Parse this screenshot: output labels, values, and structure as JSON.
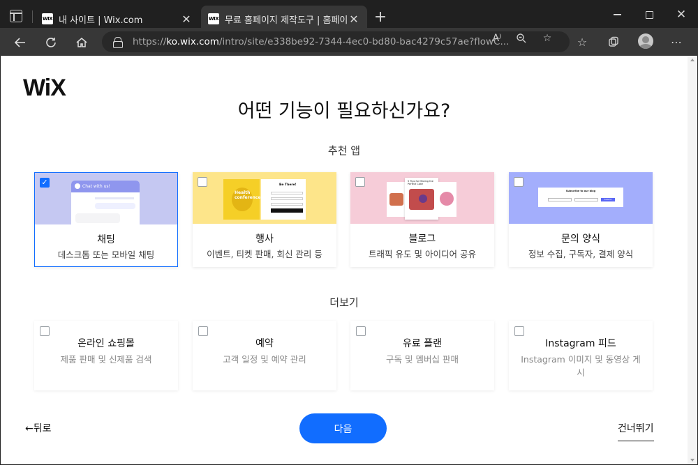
{
  "browser": {
    "tabs": [
      {
        "favicon": "WIX",
        "title": "내 사이트 | Wix.com",
        "active": false
      },
      {
        "favicon": "WIX",
        "title": "무료 홈페이지 제작도구 | 홈페이지",
        "active": true
      }
    ],
    "url": {
      "protocol": "https://",
      "host": "ko.wix.com",
      "path": "/intro/site/e338be92-7344-4ec0-bd80-bac4279c57ae?flowC..."
    }
  },
  "page": {
    "logo": "WiX",
    "heading": "어떤 기능이 필요하신가요?",
    "recommended_label": "추천 앱",
    "more_label": "더보기",
    "recommended": [
      {
        "title": "채팅",
        "subtitle": "데스크톱 또는 모바일 채팅",
        "checked": true,
        "image_bg": "#c5c8f2"
      },
      {
        "title": "행사",
        "subtitle": "이벤트, 티켓 판매, 회신 관리 등",
        "checked": false,
        "image_bg": "#fde58a"
      },
      {
        "title": "블로그",
        "subtitle": "트래픽 유도 및 아이디어 공유",
        "checked": false,
        "image_bg": "#f6ccd8"
      },
      {
        "title": "문의 양식",
        "subtitle": "정보 수집, 구독자, 결제 양식",
        "checked": false,
        "image_bg": "#a3aefc"
      }
    ],
    "more": [
      {
        "title": "온라인 쇼핑몰",
        "subtitle": "제품 판매 및 신제품 검색",
        "checked": false
      },
      {
        "title": "예약",
        "subtitle": "고객 일정 및 예약 관리",
        "checked": false
      },
      {
        "title": "유료 플랜",
        "subtitle": "구독 및 멤버십 판매",
        "checked": false
      },
      {
        "title": "Instagram 피드",
        "subtitle": "Instagram 이미지 및 동영상 게시",
        "checked": false
      }
    ],
    "back_label": "←뒤로",
    "next_label": "다음",
    "skip_label": "건너뛰기",
    "art": {
      "chat_header": "Chat with us!",
      "chat_msg": "Hi, you skip conversation...",
      "event_title": "Health conference",
      "event_form_title": "Be There!",
      "blog_post_title": "5 Tips for Making the Perfect Cake",
      "form_title": "Subscribe to our blog",
      "form_button": "Submit"
    }
  },
  "colors": {
    "accent": "#116dff",
    "selected_border": "#116dff"
  }
}
